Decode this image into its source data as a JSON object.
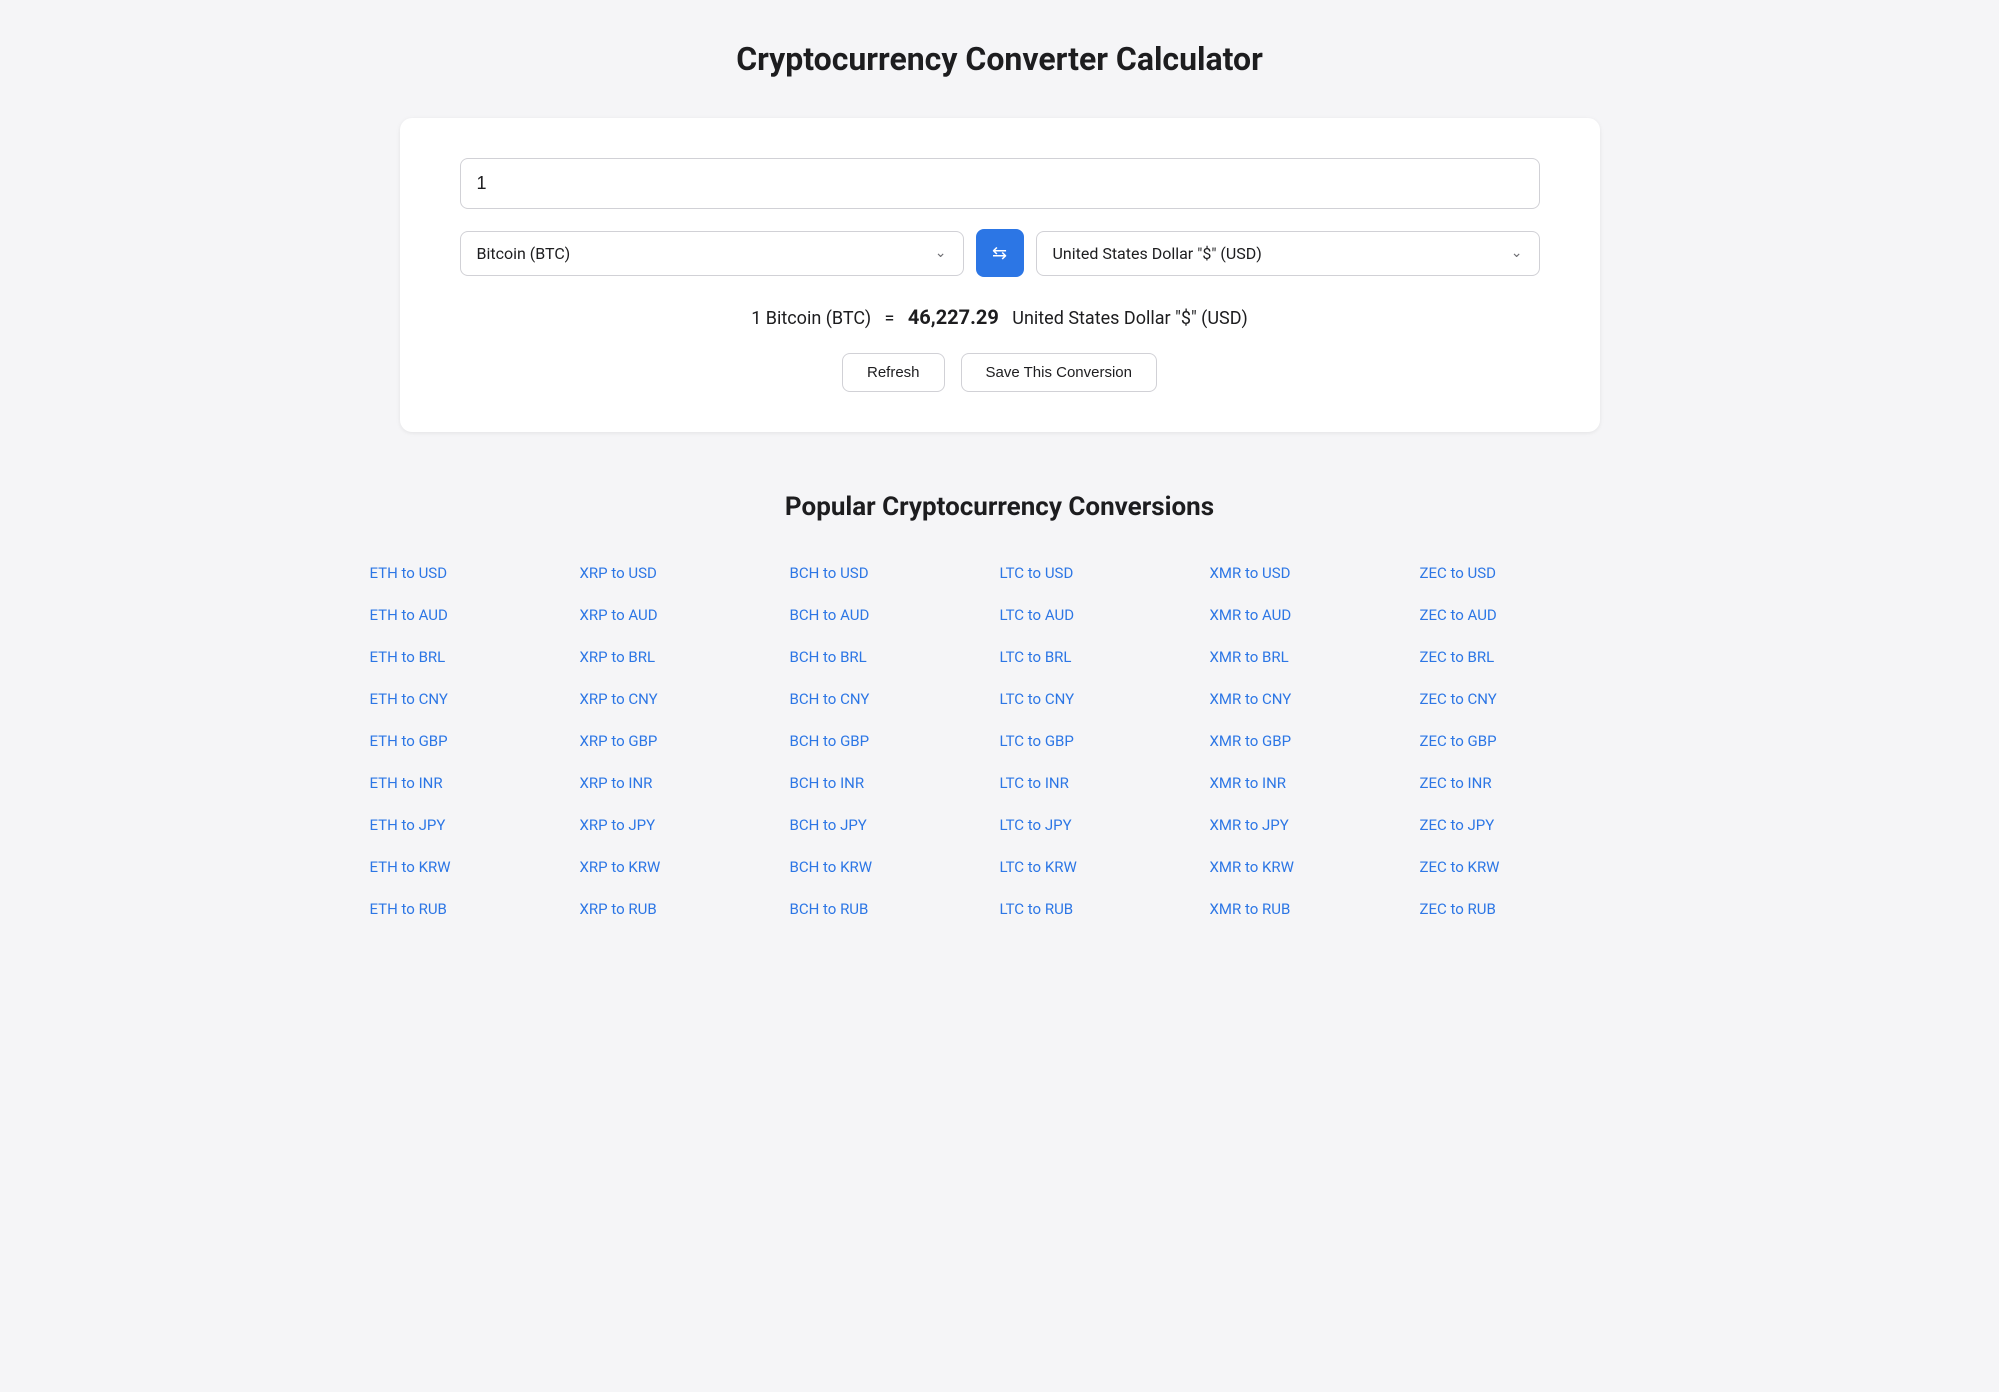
{
  "page": {
    "title": "Cryptocurrency Converter Calculator"
  },
  "converter": {
    "amount_value": "1",
    "from_currency": "Bitcoin (BTC)",
    "to_currency": "United States Dollar \"$\" (USD)",
    "result_text": "1 Bitcoin (BTC)",
    "equals": "=",
    "result_amount": "46,227.29",
    "result_currency": "United States Dollar \"$\" (USD)",
    "refresh_label": "Refresh",
    "save_label": "Save This Conversion",
    "swap_icon": "⇄"
  },
  "popular": {
    "title": "Popular Cryptocurrency Conversions",
    "columns": [
      {
        "items": [
          "ETH to USD",
          "ETH to AUD",
          "ETH to BRL",
          "ETH to CNY",
          "ETH to GBP",
          "ETH to INR",
          "ETH to JPY",
          "ETH to KRW",
          "ETH to RUB"
        ]
      },
      {
        "items": [
          "XRP to USD",
          "XRP to AUD",
          "XRP to BRL",
          "XRP to CNY",
          "XRP to GBP",
          "XRP to INR",
          "XRP to JPY",
          "XRP to KRW",
          "XRP to RUB"
        ]
      },
      {
        "items": [
          "BCH to USD",
          "BCH to AUD",
          "BCH to BRL",
          "BCH to CNY",
          "BCH to GBP",
          "BCH to INR",
          "BCH to JPY",
          "BCH to KRW",
          "BCH to RUB"
        ]
      },
      {
        "items": [
          "LTC to USD",
          "LTC to AUD",
          "LTC to BRL",
          "LTC to CNY",
          "LTC to GBP",
          "LTC to INR",
          "LTC to JPY",
          "LTC to KRW",
          "LTC to RUB"
        ]
      },
      {
        "items": [
          "XMR to USD",
          "XMR to AUD",
          "XMR to BRL",
          "XMR to CNY",
          "XMR to GBP",
          "XMR to INR",
          "XMR to JPY",
          "XMR to KRW",
          "XMR to RUB"
        ]
      },
      {
        "items": [
          "ZEC to USD",
          "ZEC to AUD",
          "ZEC to BRL",
          "ZEC to CNY",
          "ZEC to GBP",
          "ZEC to INR",
          "ZEC to JPY",
          "ZEC to KRW",
          "ZEC to RUB"
        ]
      }
    ]
  }
}
